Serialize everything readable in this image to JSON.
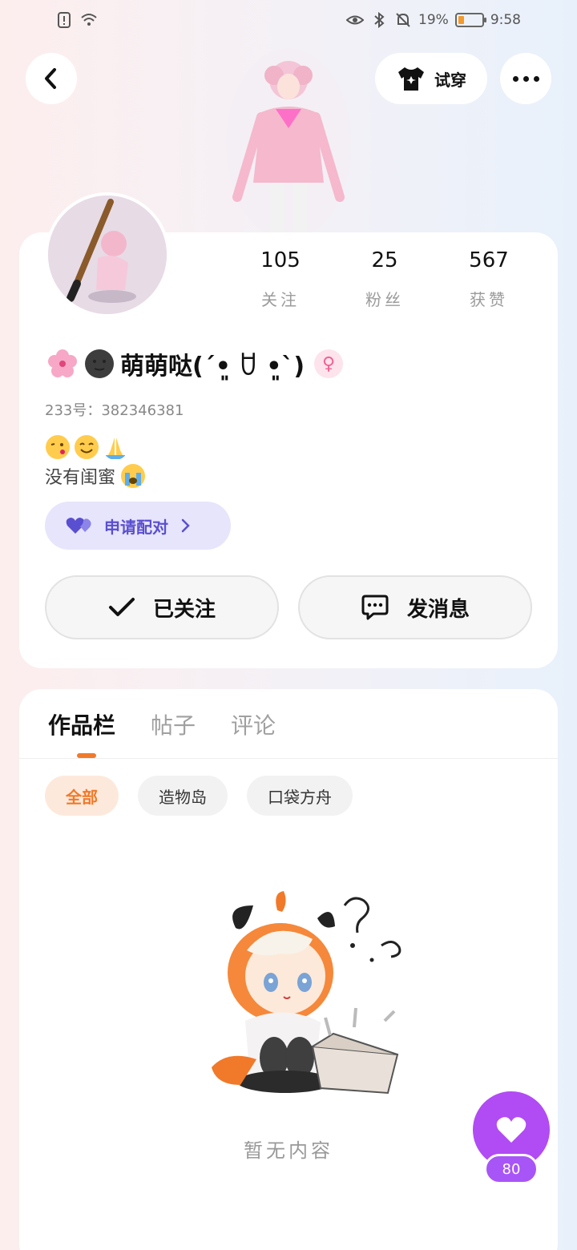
{
  "status_bar": {
    "battery_percent": "19%",
    "time": "9:58",
    "left_icons": [
      "alert-icon",
      "wifi-icon"
    ],
    "right_icons": [
      "eye-icon",
      "bluetooth-icon",
      "mute-bell-icon",
      "battery-icon"
    ],
    "battery_level": 0.19
  },
  "header": {
    "try_on_label": "试穿",
    "icons": [
      "back-icon",
      "tshirt-icon",
      "more-icon"
    ]
  },
  "profile": {
    "stats": [
      {
        "value": "105",
        "label": "关注"
      },
      {
        "value": "25",
        "label": "粉丝"
      },
      {
        "value": "567",
        "label": "获赞"
      }
    ],
    "nickname": "萌萌哒(ˊ•͈ ꇴ •͈ˋ)",
    "name_emojis": [
      "cherry-blossom-icon",
      "dark-moon-face-icon"
    ],
    "gender_icon": "female-icon",
    "gender_symbol": "♀",
    "id_text": "233号：382346381",
    "bio_emojis": [
      "kissing-face-icon",
      "smiling-face-icon",
      "folded-hands-icon"
    ],
    "bio_text": "没有闺蜜",
    "bio_trailing_emoji": "loudly-crying-face-icon",
    "pair_button_label": "申请配对",
    "follow_button_label": "已关注",
    "message_button_label": "发消息"
  },
  "content": {
    "tabs": [
      "作品栏",
      "帖子",
      "评论"
    ],
    "active_tab": 0,
    "chips": [
      "全部",
      "造物岛",
      "口袋方舟"
    ],
    "active_chip": 0,
    "empty_text": "暂无内容"
  },
  "like_fab": {
    "count": "80"
  },
  "colors": {
    "accent_orange": "#f07a2a",
    "pair_purple": "#5a4fd0",
    "like_purple": "#b14bf4"
  }
}
